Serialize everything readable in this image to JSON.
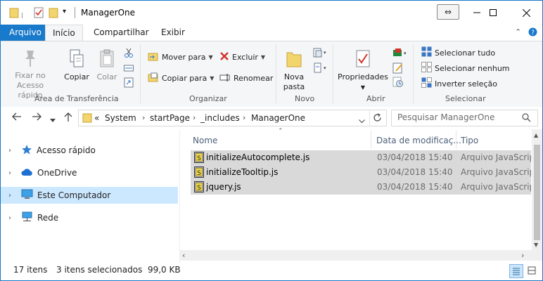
{
  "window": {
    "title": "ManagerOne",
    "colors": {
      "accent": "#1979ca",
      "selected_nav": "#cce8ff",
      "selected_row": "#d9d9d9"
    }
  },
  "ribbon": {
    "tabs": {
      "file": "Arquivo",
      "home": "Início",
      "share": "Compartilhar",
      "view": "Exibir"
    },
    "groups": {
      "clipboard": {
        "label": "Área de Transferência",
        "pin_label_1": "Fixar no",
        "pin_label_2": "Acesso rápido",
        "copy": "Copiar",
        "paste": "Colar"
      },
      "organize": {
        "label": "Organizar",
        "move_to": "Mover para",
        "copy_to": "Copiar para",
        "delete": "Excluir",
        "rename": "Renomear"
      },
      "new": {
        "label": "Novo",
        "new_folder_1": "Nova",
        "new_folder_2": "pasta"
      },
      "open": {
        "label": "Abrir",
        "properties": "Propriedades"
      },
      "select": {
        "label": "Selecionar",
        "select_all": "Selecionar tudo",
        "select_none": "Selecionar nenhum",
        "invert": "Inverter seleção"
      }
    }
  },
  "address": {
    "prefix": "«",
    "crumbs": [
      "System",
      "startPage",
      "_includes",
      "ManagerOne"
    ],
    "search_placeholder": "Pesquisar ManagerOne"
  },
  "nav": {
    "items": [
      {
        "label": "Acesso rápido",
        "icon": "star-icon"
      },
      {
        "label": "OneDrive",
        "icon": "cloud-icon"
      },
      {
        "label": "Este Computador",
        "icon": "computer-icon",
        "selected": true
      },
      {
        "label": "Rede",
        "icon": "network-icon"
      }
    ]
  },
  "list": {
    "headers": {
      "name": "Nome",
      "date": "Data de modificaç...",
      "type": "Tipo"
    },
    "rows": [
      {
        "name": "initializeAutocomplete.js",
        "date": "03/04/2018 15:40",
        "type": "Arquivo JavaScript"
      },
      {
        "name": "initializeTooltip.js",
        "date": "03/04/2018 15:40",
        "type": "Arquivo JavaScript"
      },
      {
        "name": "jquery.js",
        "date": "03/04/2018 15:40",
        "type": "Arquivo JavaScript"
      }
    ]
  },
  "status": {
    "count": "17 itens",
    "selected": "3 itens selecionados  99,0 KB"
  }
}
